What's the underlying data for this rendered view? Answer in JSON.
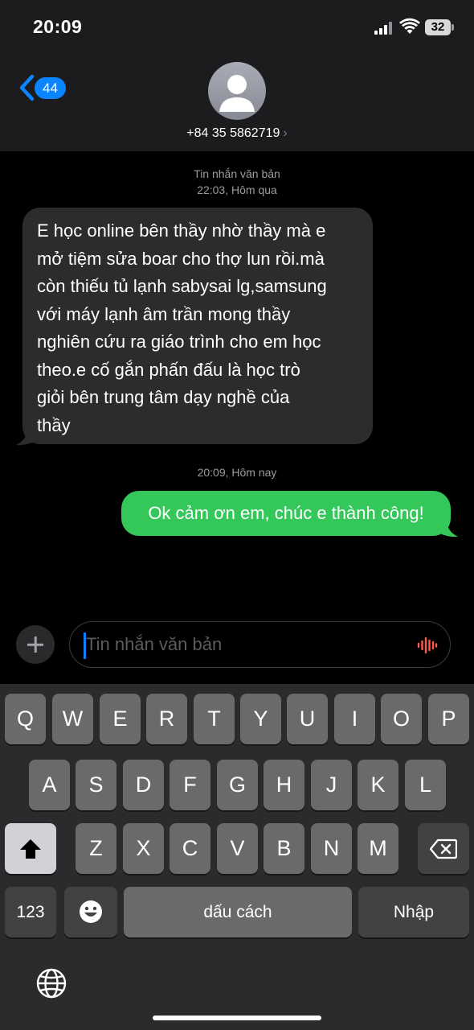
{
  "status_bar": {
    "time": "20:09",
    "battery": "32"
  },
  "header": {
    "back_count": "44",
    "contact": "+84 35 5862719",
    "contact_chevron": "›"
  },
  "thread": {
    "service_label": "Tin nhắn văn bản",
    "first_timestamp": "22:03, Hôm qua",
    "incoming_lines": [
      "E học online bên thầy nhờ thầy mà e",
      "mở tiệm sửa boar cho thợ lun rồi.mà",
      "còn thiếu tủ lạnh sabysai lg,samsung",
      "với máy lạnh âm trần mong thầy",
      "nghiên cứu ra giáo trình cho em học",
      "theo.e cố gắn phấn đấu là học trò",
      "giỏi bên trung tâm dạy nghề của",
      "thầy"
    ],
    "second_timestamp": "20:09, Hôm nay",
    "outgoing_message": "Ok cảm ơn em, chúc e thành công!"
  },
  "composer": {
    "placeholder": "Tin nhắn văn bản",
    "accent_color": "#0a84ff",
    "mic_color": "#ff5a4a"
  },
  "keyboard": {
    "row1": [
      "Q",
      "W",
      "E",
      "R",
      "T",
      "Y",
      "U",
      "I",
      "O",
      "P"
    ],
    "row2": [
      "A",
      "S",
      "D",
      "F",
      "G",
      "H",
      "J",
      "K",
      "L"
    ],
    "row3": [
      "Z",
      "X",
      "C",
      "V",
      "B",
      "N",
      "M"
    ],
    "numbers_label": "123",
    "space_label": "dấu cách",
    "return_label": "Nhập",
    "shift_icon": "shift-icon",
    "delete_icon": "delete-icon",
    "emoji_icon": "emoji-icon",
    "globe_icon": "globe-icon"
  },
  "colors": {
    "incoming_bubble": "#2c2c2e",
    "outgoing_bubble": "#34c759",
    "badge": "#0a84ff"
  }
}
